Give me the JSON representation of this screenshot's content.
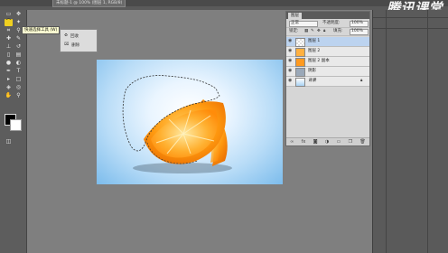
{
  "window": {
    "doc_tab": "未标题-1 @ 100% (图层 1, RGB/8)",
    "watermark": "腾讯课堂"
  },
  "tooltip": "快速选择工具 (W)",
  "flyout": {
    "items": [
      {
        "icon": "recycle-icon",
        "label": "回收"
      },
      {
        "icon": "delete-icon",
        "label": "删除"
      }
    ]
  },
  "layers_panel": {
    "tab_label": "图层",
    "blend_mode": "正常",
    "opacity_label": "不透明度:",
    "opacity_value": "100%",
    "lock_label": "锁定:",
    "fill_label": "填充:",
    "fill_value": "100%",
    "layers": [
      {
        "name": "图层 1",
        "active": true
      },
      {
        "name": "图层 2",
        "active": false
      },
      {
        "name": "图层 2 副本",
        "active": false
      },
      {
        "name": "阴影",
        "active": false
      },
      {
        "name": "背景",
        "active": false
      }
    ]
  },
  "colors": {
    "foreground": "#000000",
    "background": "#ffffff",
    "active_tool": "#f0d020",
    "orange": "#ff8c0a"
  }
}
